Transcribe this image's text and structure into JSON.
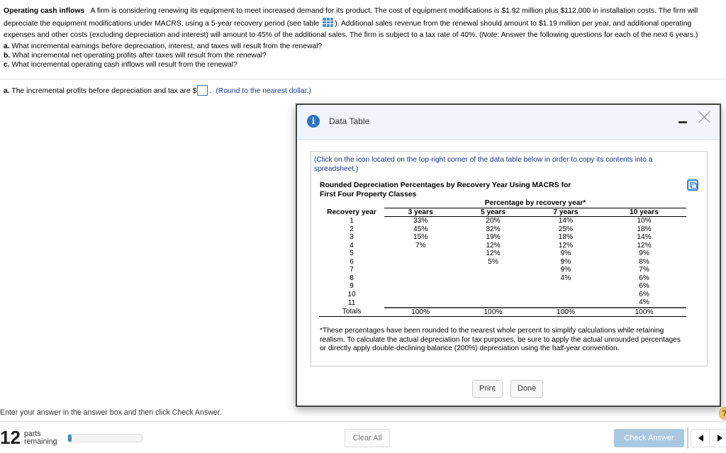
{
  "question": {
    "title": "Operating cash inflows",
    "text_part1": "A firm is considering renewing its equipment to meet increased demand for its product.  The cost of equipment modifications is $1.92 million plus $112,000 in installation costs.  The firm will depreciate the equipment modifications under MACRS, using a 5-year recovery period (see table",
    "text_part2": ").  Additional sales revenue from the renewal should amount to $1.19 million per year, and additional operating expenses and other costs (excluding depreciation and interest) will amount to 45% of the additional sales.  The firm is subject to a tax rate of 40%. (",
    "note_label": "Note",
    "text_part3": ": Answer the following questions for each of the next 6 years.)",
    "items": [
      {
        "letter": "a.",
        "text": " What incremental earnings before depreciation, interest, and taxes will result from the renewal?"
      },
      {
        "letter": "b.",
        "text": " What incremental net operating profits after taxes will result from the renewal?"
      },
      {
        "letter": "c.",
        "text": " What incremental operating cash inflows will result from the renewal?"
      }
    ]
  },
  "answer": {
    "letter": "a.",
    "prefix": " The incremental profits before depreciation and tax are $",
    "value": "",
    "suffix": ".",
    "hint": "(Round to the nearest dollar.)"
  },
  "dialog": {
    "title": "Data Table",
    "click_note": "(Click on the icon located on the top-right corner of the data table below in order to copy its contents into a spreadsheet.)",
    "table_title_line1": "Rounded Depreciation Percentages by Recovery Year Using MACRS for",
    "table_title_line2": "First Four Property Classes",
    "group_header": "Percentage by recovery year*",
    "columns": [
      "Recovery year",
      "3 years",
      "5 years",
      "7 years",
      "10 years"
    ],
    "rows": [
      [
        "1",
        "33%",
        "20%",
        "14%",
        "10%"
      ],
      [
        "2",
        "45%",
        "32%",
        "25%",
        "18%"
      ],
      [
        "3",
        "15%",
        "19%",
        "18%",
        "14%"
      ],
      [
        "4",
        "7%",
        "12%",
        "12%",
        "12%"
      ],
      [
        "5",
        "",
        "12%",
        "9%",
        "9%"
      ],
      [
        "6",
        "",
        "5%",
        "9%",
        "8%"
      ],
      [
        "7",
        "",
        "",
        "9%",
        "7%"
      ],
      [
        "8",
        "",
        "",
        "4%",
        "6%"
      ],
      [
        "9",
        "",
        "",
        "",
        "6%"
      ],
      [
        "10",
        "",
        "",
        "",
        "6%"
      ],
      [
        "11",
        "",
        "",
        "",
        "4%"
      ]
    ],
    "totals": [
      "Totals",
      "100%",
      "100%",
      "100%",
      "100%"
    ],
    "footnote": "*These percentages have been rounded to the nearest whole percent to simplify calculations while retaining realism. To calculate the actual depreciation for tax purposes, be sure to apply the actual unrounded percentages or directly apply double-declining balance (200%) depreciation using the half-year convention.",
    "print_label": "Print",
    "done_label": "Done"
  },
  "footer": {
    "instruction": "Enter your answer in the answer box and then click Check Answer.",
    "parts_count": "12",
    "parts_label_1": "parts",
    "parts_label_2": "remaining",
    "progress_fraction": 0.05,
    "clear_all_label": "Clear All",
    "check_answer_label": "Check Answer",
    "help_glyph": "?"
  },
  "colors": {
    "accent": "#2a73c9",
    "hint_text": "#1a3a99",
    "check_answer_disabled": "#a9c7e0",
    "progress_fill": "#4a86c8"
  }
}
